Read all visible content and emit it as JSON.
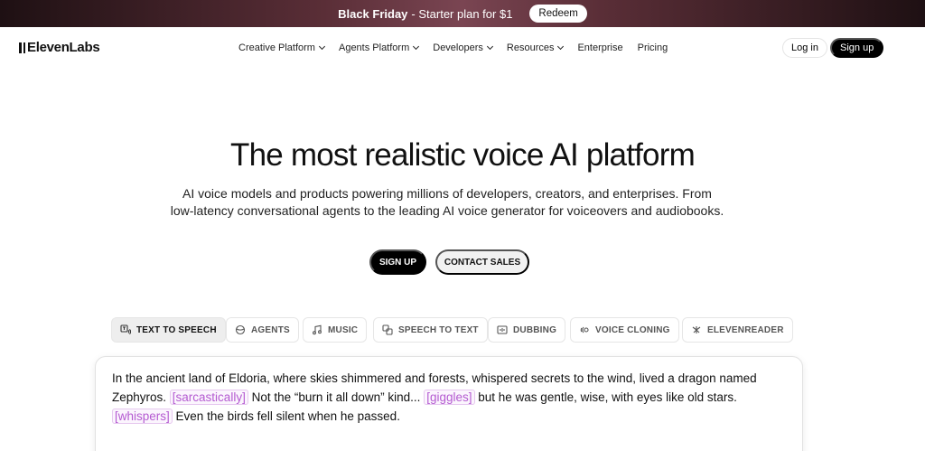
{
  "banner": {
    "highlight": "Black Friday",
    "text": "- Starter plan for $1",
    "redeem_label": "Redeem"
  },
  "header": {
    "logo": "ElevenLabs",
    "nav": [
      {
        "label": "Creative Platform",
        "has_menu": true
      },
      {
        "label": "Agents Platform",
        "has_menu": true
      },
      {
        "label": "Developers",
        "has_menu": true
      },
      {
        "label": "Resources",
        "has_menu": true
      },
      {
        "label": "Enterprise",
        "has_menu": false
      },
      {
        "label": "Pricing",
        "has_menu": false
      }
    ],
    "login_label": "Log in",
    "signup_label": "Sign up"
  },
  "hero": {
    "title": "The most realistic voice AI platform",
    "subtitle_line1": "AI voice models and products powering millions of developers, creators, and enterprises. From",
    "subtitle_line2": "low-latency conversational agents to the leading AI voice generator for voiceovers and audiobooks.",
    "cta_primary": "SIGN UP",
    "cta_secondary": "CONTACT SALES"
  },
  "tabs": [
    {
      "label": "TEXT TO SPEECH",
      "icon": "text-to-speech-icon",
      "active": true
    },
    {
      "label": "AGENTS",
      "icon": "agents-icon",
      "active": false
    },
    {
      "label": "MUSIC",
      "icon": "music-note-icon",
      "active": false
    },
    {
      "label": "SPEECH TO TEXT",
      "icon": "speech-to-text-icon",
      "active": false
    },
    {
      "label": "DUBBING",
      "icon": "dubbing-icon",
      "active": false
    },
    {
      "label": "VOICE CLONING",
      "icon": "voice-cloning-icon",
      "active": false
    },
    {
      "label": "ELEVENREADER",
      "icon": "elevenreader-icon",
      "active": false
    }
  ],
  "card": {
    "p1": "In the ancient land of Eldoria, where skies shimmered and forests, whispered secrets to the wind, lived a dragon named Zephyros.",
    "tag1": "[sarcastically]",
    "p2": "Not the “burn it all down” kind...",
    "tag2": "[giggles]",
    "p3": "but he was gentle, wise, with eyes like old stars.",
    "tag3": "[whispers]",
    "p4": "Even the birds fell silent when he passed."
  },
  "colors": {
    "tag_purple": "#b45ad1",
    "banner_accent": "#7a4552"
  }
}
